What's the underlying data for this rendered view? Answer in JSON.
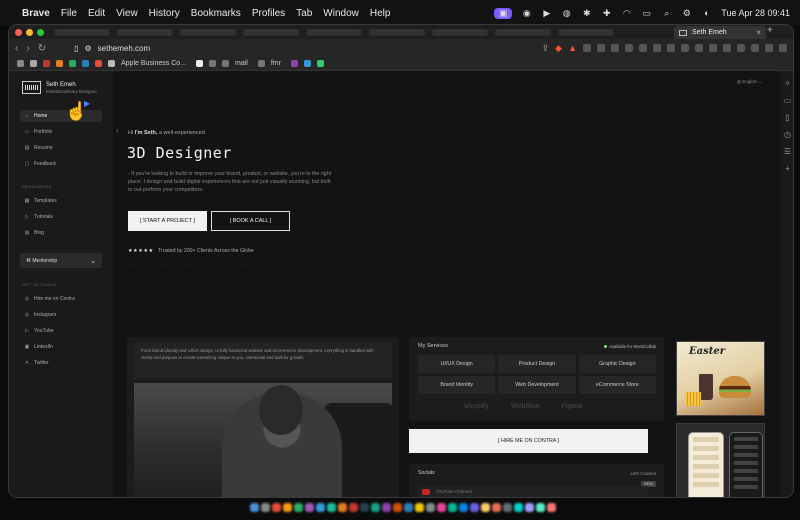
{
  "menubar": {
    "app": "Brave",
    "items": [
      "File",
      "Edit",
      "View",
      "History",
      "Bookmarks",
      "Profiles",
      "Tab",
      "Window",
      "Help"
    ],
    "clock": "Tue Apr 28  09:41"
  },
  "browser": {
    "active_tab": "Seth Emeh",
    "url": "sethemeh.com",
    "bookmarks": [
      "Apple Business Co...",
      "mail",
      "fmr"
    ]
  },
  "sidebar": {
    "name": "Seth Emeh",
    "role": "Multidisciplinary Designer",
    "nav": [
      {
        "label": "Home",
        "icon": "home-icon",
        "glyph": "⌂"
      },
      {
        "label": "Portfolio",
        "icon": "folder-icon",
        "glyph": "▭"
      },
      {
        "label": "Resume",
        "icon": "document-icon",
        "glyph": "▤"
      },
      {
        "label": "Feedback",
        "icon": "chat-icon",
        "glyph": "▢"
      }
    ],
    "resources_label": "RESOURCES",
    "resources": [
      {
        "label": "Templates",
        "icon": "template-icon",
        "glyph": "▦"
      },
      {
        "label": "Tutorials",
        "icon": "play-icon",
        "glyph": "▷"
      },
      {
        "label": "Blog",
        "icon": "blog-icon",
        "glyph": "▤"
      }
    ],
    "mentorship": "Mentorship",
    "touch_label": "GET IN TOUCH",
    "contacts": [
      {
        "label": "Hire me on Contra",
        "icon": "contra-icon",
        "glyph": "◎"
      },
      {
        "label": "Instagram",
        "icon": "instagram-icon",
        "glyph": "◎"
      },
      {
        "label": "YouTube",
        "icon": "youtube-icon",
        "glyph": "▷"
      },
      {
        "label": "LinkedIn",
        "icon": "linkedin-icon",
        "glyph": "▣"
      },
      {
        "label": "Twitter",
        "icon": "twitter-icon",
        "glyph": "✕"
      }
    ]
  },
  "hero": {
    "language": "English",
    "intro_hi": "Hi",
    "intro_name": "I'm Seth,",
    "intro_rest": "a well-experienced",
    "title": "3D Designer",
    "description": "- If you're looking to build or improve your brand, product, or website, you're in the right place. I design and build digital experiences that are not just visually stunning, but built to out-perform your competitors.",
    "primary_button": "[ START A PROJECT ]",
    "secondary_button": "[ BOOK A CALL ]",
    "stars": "★★★★★",
    "trusted": "Trusted by 200+ Clients Across the Globe"
  },
  "story": {
    "text": "From brand identity and UI/UX design, to fully functional website and eCommerce development, everything is handled with clarity and purpose to create something unique to you, intentional and built for growth."
  },
  "services": {
    "title": "My Services",
    "availability": "Available for Work/Collab",
    "items": [
      "UI/UX Design",
      "Product Design",
      "Graphic Design",
      "Brand Identity",
      "Web Development",
      "eCommerce Store"
    ],
    "tools": [
      "shopify",
      "Webflow",
      "Figma"
    ],
    "hire_button": "[ HIRE ME ON CONTRA ]"
  },
  "socials": {
    "title": "Socials",
    "connect": "Let's Connect",
    "new_badge": "NEW",
    "youtube": "YouTube Channel"
  },
  "thumb": {
    "food_title": "Easter"
  }
}
